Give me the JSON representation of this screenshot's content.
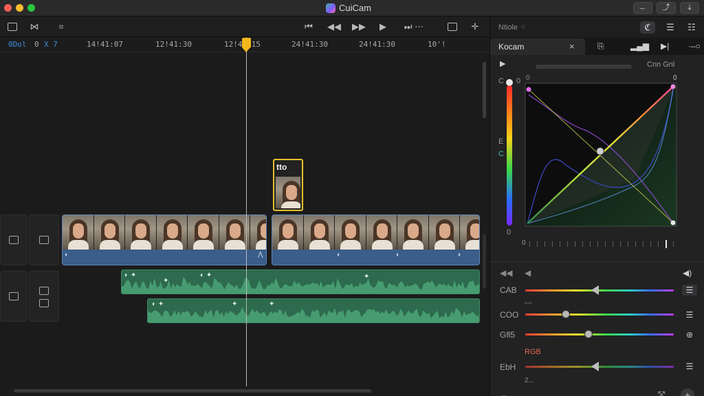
{
  "app": {
    "title": "CuiCam"
  },
  "window_buttons": [
    "←",
    "⤴",
    "⤓"
  ],
  "toolbar": {
    "left_icons": [
      "clip-icon",
      "trim-icon",
      "snap-icon"
    ],
    "right_icons": [
      "rewind-icon",
      "play-back-icon",
      "play-forward-icon",
      "play-icon",
      "skip-icon",
      "index-icon",
      "crop-icon"
    ]
  },
  "ruler": {
    "prefix_a": "0Dol",
    "prefix_b": "0",
    "prefix_c": "X 7",
    "labels": [
      "14!41:07",
      "12!41:30",
      "12!41:15",
      "24!41:30",
      "24!41:30",
      "10'!"
    ]
  },
  "title_clip": {
    "label": "tto"
  },
  "inspector": {
    "header_title": "Ntiole",
    "header_suffix": "⁘",
    "tab_label": "Kocam",
    "close_label": "×",
    "sub_row_value_a": "0",
    "sub_row_value_b": "0",
    "sub_row_text": "Cnn Gnl",
    "range_min": "0",
    "range_max": "0",
    "top_values": [
      "C",
      "0"
    ],
    "mid_values": [
      "E",
      "C"
    ],
    "bottom_value": "0",
    "adjustments": [
      {
        "label": "CAB",
        "value": 0.47
      },
      {
        "label": "COO",
        "value": 0.27
      },
      {
        "label": "Gfl5",
        "value": 0.43
      },
      {
        "label": "EbH",
        "value": 0.47
      }
    ],
    "rgb_label": "RGB",
    "footer_small": "2...",
    "footer_dots": "..."
  }
}
